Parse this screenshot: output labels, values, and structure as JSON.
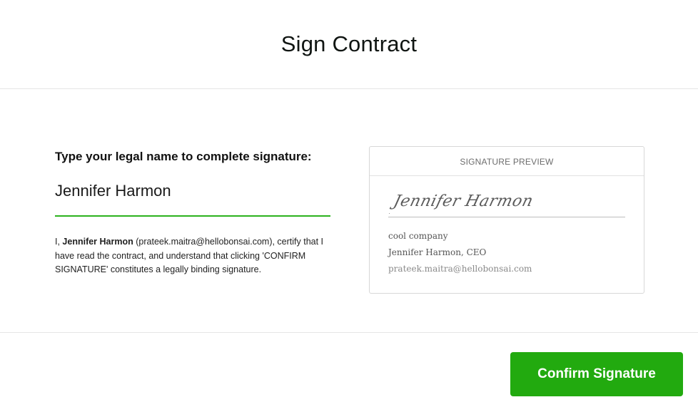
{
  "page": {
    "title": "Sign Contract"
  },
  "signature_form": {
    "prompt": "Type your legal name to complete signature:",
    "name_value": "Jennifer Harmon",
    "consent": {
      "prefix": "I, ",
      "name": "Jennifer Harmon",
      "suffix": " (prateek.maitra@hellobonsai.com), certify that I have read the contract, and understand that clicking 'CONFIRM SIGNATURE' constitutes a legally binding signature."
    }
  },
  "signature_preview": {
    "header": "SIGNATURE PREVIEW",
    "signature_text": "Jennifer Harmon",
    "company": "cool company",
    "name_title": "Jennifer Harmon, CEO",
    "email": "prateek.maitra@hellobonsai.com"
  },
  "footer": {
    "confirm_label": "Confirm Signature",
    "confirm_color": "#22aa0f"
  },
  "colors": {
    "accent_green": "#2bb21e"
  }
}
